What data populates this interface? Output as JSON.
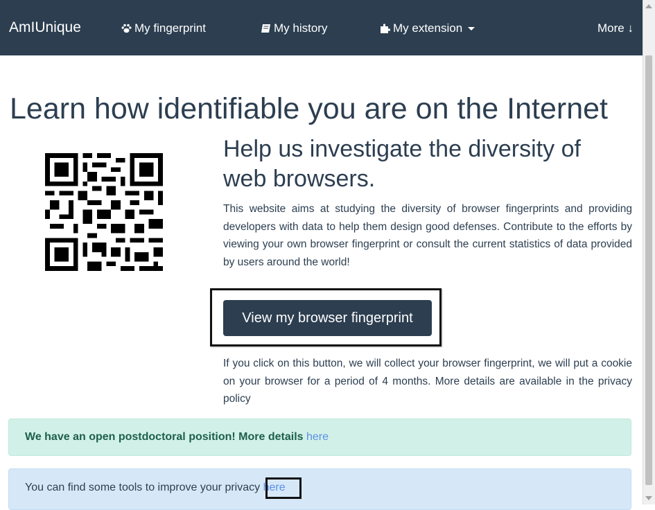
{
  "navbar": {
    "brand": "AmIUnique",
    "items": [
      {
        "label": "My fingerprint",
        "icon": "paw-icon"
      },
      {
        "label": "My history",
        "icon": "book-icon"
      },
      {
        "label": "My extension",
        "icon": "puzzle-icon"
      }
    ],
    "more_label": "More ↓",
    "background": "#2c3e50"
  },
  "main": {
    "headline": "Learn how identifiable you are on the Internet",
    "subheadline": "Help us investigate the diversity of web browsers.",
    "intro": "This website aims at studying the diversity of browser fingerprints and providing developers with data to help them design good defenses. Contribute to the efforts by viewing your own browser fingerprint or consult the current statistics of data provided by users around the world!",
    "cta_label": "View my browser fingerprint",
    "disclaimer": "If you click on this button, we will collect your browser fingerprint, we will put a cookie on your browser for a period of 4 months. More details are available in the privacy policy"
  },
  "alerts": {
    "postdoc_text": "We have an open postdoctoral position! More details",
    "postdoc_link": "here",
    "privacy_text": "You can find some tools to improve your privacy",
    "privacy_link": "here"
  },
  "colors": {
    "accent": "#2c3e50",
    "success_bg": "#d1f1e8",
    "info_bg": "#d6e8f8",
    "link": "#5b8ee6"
  }
}
